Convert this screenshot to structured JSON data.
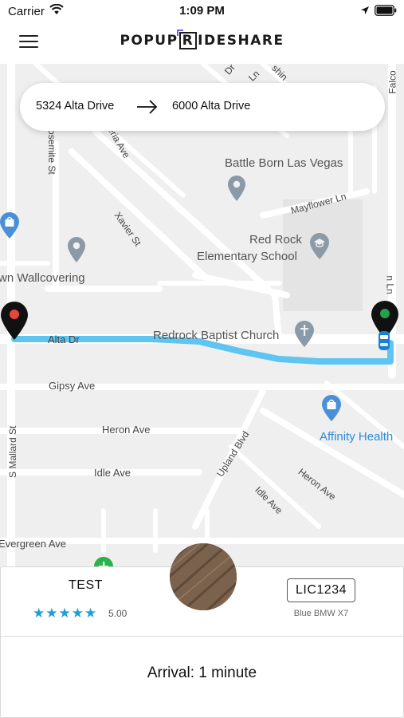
{
  "status_bar": {
    "carrier": "Carrier",
    "time": "1:09 PM",
    "icons": [
      "wifi-icon",
      "location-arrow-icon",
      "battery-icon"
    ]
  },
  "header": {
    "logo_left": "POPUP",
    "logo_r": "R",
    "logo_right": "IDESHARE",
    "menu_icon": "hamburger-menu-icon"
  },
  "route": {
    "from": "5324 Alta Drive",
    "to": "6000 Alta Drive",
    "arrow_icon": "right-arrow-icon"
  },
  "map": {
    "streets": {
      "alta_dr": "Alta Dr",
      "gipsy_ave": "Gipsy Ave",
      "heron_ave": "Heron Ave",
      "idle_ave": "Idle Ave",
      "evergreen_ave": "Evergreen Ave",
      "s_mallard_st": "S Mallard St",
      "yosemite_st": "osemite St",
      "wisteria_ave": "teria Ave",
      "xavier_st": "Xavier St",
      "mayflower_ln": "Mayflower Ln",
      "upland_blvd": "Upland Blvd",
      "heron_ave_diag": "Heron Ave",
      "idle_ave_diag": "Idle Ave",
      "falcon": "Falco",
      "ln_right": "n Ln",
      "dr_ln_top": "Dr",
      "ln_top": "Ln",
      "shin_top": "shin"
    },
    "pois": {
      "battle_born": "Battle Born Las Vegas",
      "red_rock_1": "Red Rock",
      "red_rock_2": "Elementary School",
      "church": "Redrock Baptist Church",
      "affinity": "Affinity Health",
      "wallcovering": "wn Wallcovering"
    },
    "colors": {
      "route": "#5ec5f1",
      "road": "#ffffff",
      "land": "#f0f0f0",
      "poi_text": "#555555",
      "poi_blue": "#2e8ad8",
      "origin_dot": "#e8453c",
      "dest_dot": "#22a34b"
    }
  },
  "driver": {
    "name": "TEST",
    "stars": "★★★★★",
    "rating": "5.00",
    "plate": "LIC1234",
    "vehicle": "Blue BMW X7",
    "arrival": "Arrival: 1 minute"
  }
}
